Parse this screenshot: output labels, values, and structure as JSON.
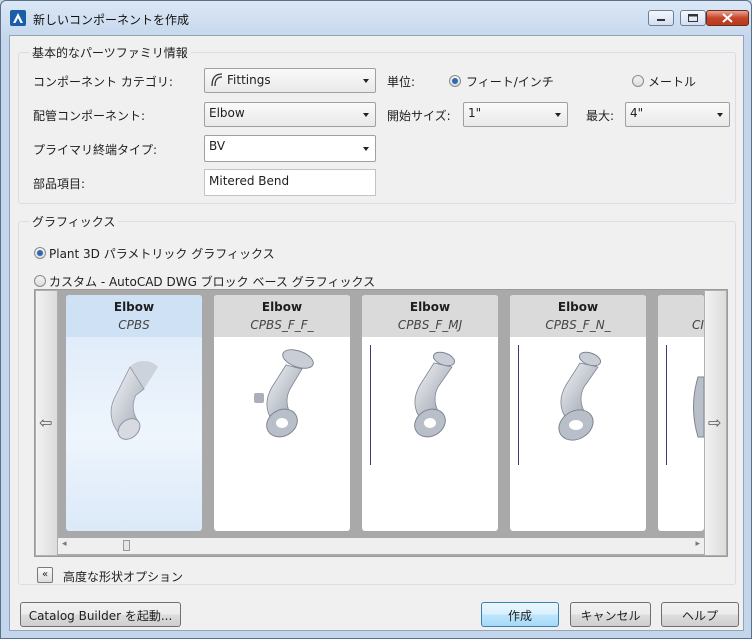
{
  "window": {
    "title": "新しいコンポーネントを作成"
  },
  "basic": {
    "group_title": "基本的なパーツファミリ情報",
    "category_label": "コンポーネント カテゴリ:",
    "category_value": "Fittings",
    "component_label": "配管コンポーネント:",
    "component_value": "Elbow",
    "end_type_label": "プライマリ終端タイプ:",
    "end_type_value": "BV",
    "item_label": "部品項目:",
    "item_value": "Mitered Bend",
    "unit_label": "単位:",
    "unit_imperial": "フィート/インチ",
    "unit_metric": "メートル",
    "unit_selected": "imperial",
    "start_size_label": "開始サイズ:",
    "start_size_value": "1\"",
    "max_label": "最大:",
    "max_value": "4\""
  },
  "graphics": {
    "group_title": "グラフィックス",
    "option_plant3d": "Plant 3D パラメトリック グラフィックス",
    "option_autocad": "カスタム - AutoCAD DWG ブロック ベース グラフィックス",
    "selected": "plant3d",
    "cards": [
      {
        "name": "Elbow",
        "sub": "CPBS"
      },
      {
        "name": "Elbow",
        "sub": "CPBS_F_F_"
      },
      {
        "name": "Elbow",
        "sub": "CPBS_F_MJ"
      },
      {
        "name": "Elbow",
        "sub": "CPBS_F_N_"
      },
      {
        "name": "",
        "sub": "CI"
      }
    ]
  },
  "advanced": {
    "label": "高度な形状オプション"
  },
  "footer": {
    "catalog_builder": "Catalog Builder を起動...",
    "create": "作成",
    "cancel": "キャンセル",
    "help": "ヘルプ"
  },
  "colors": {
    "accent": "#2e69b1",
    "selected_card": "#cfe2f5"
  }
}
